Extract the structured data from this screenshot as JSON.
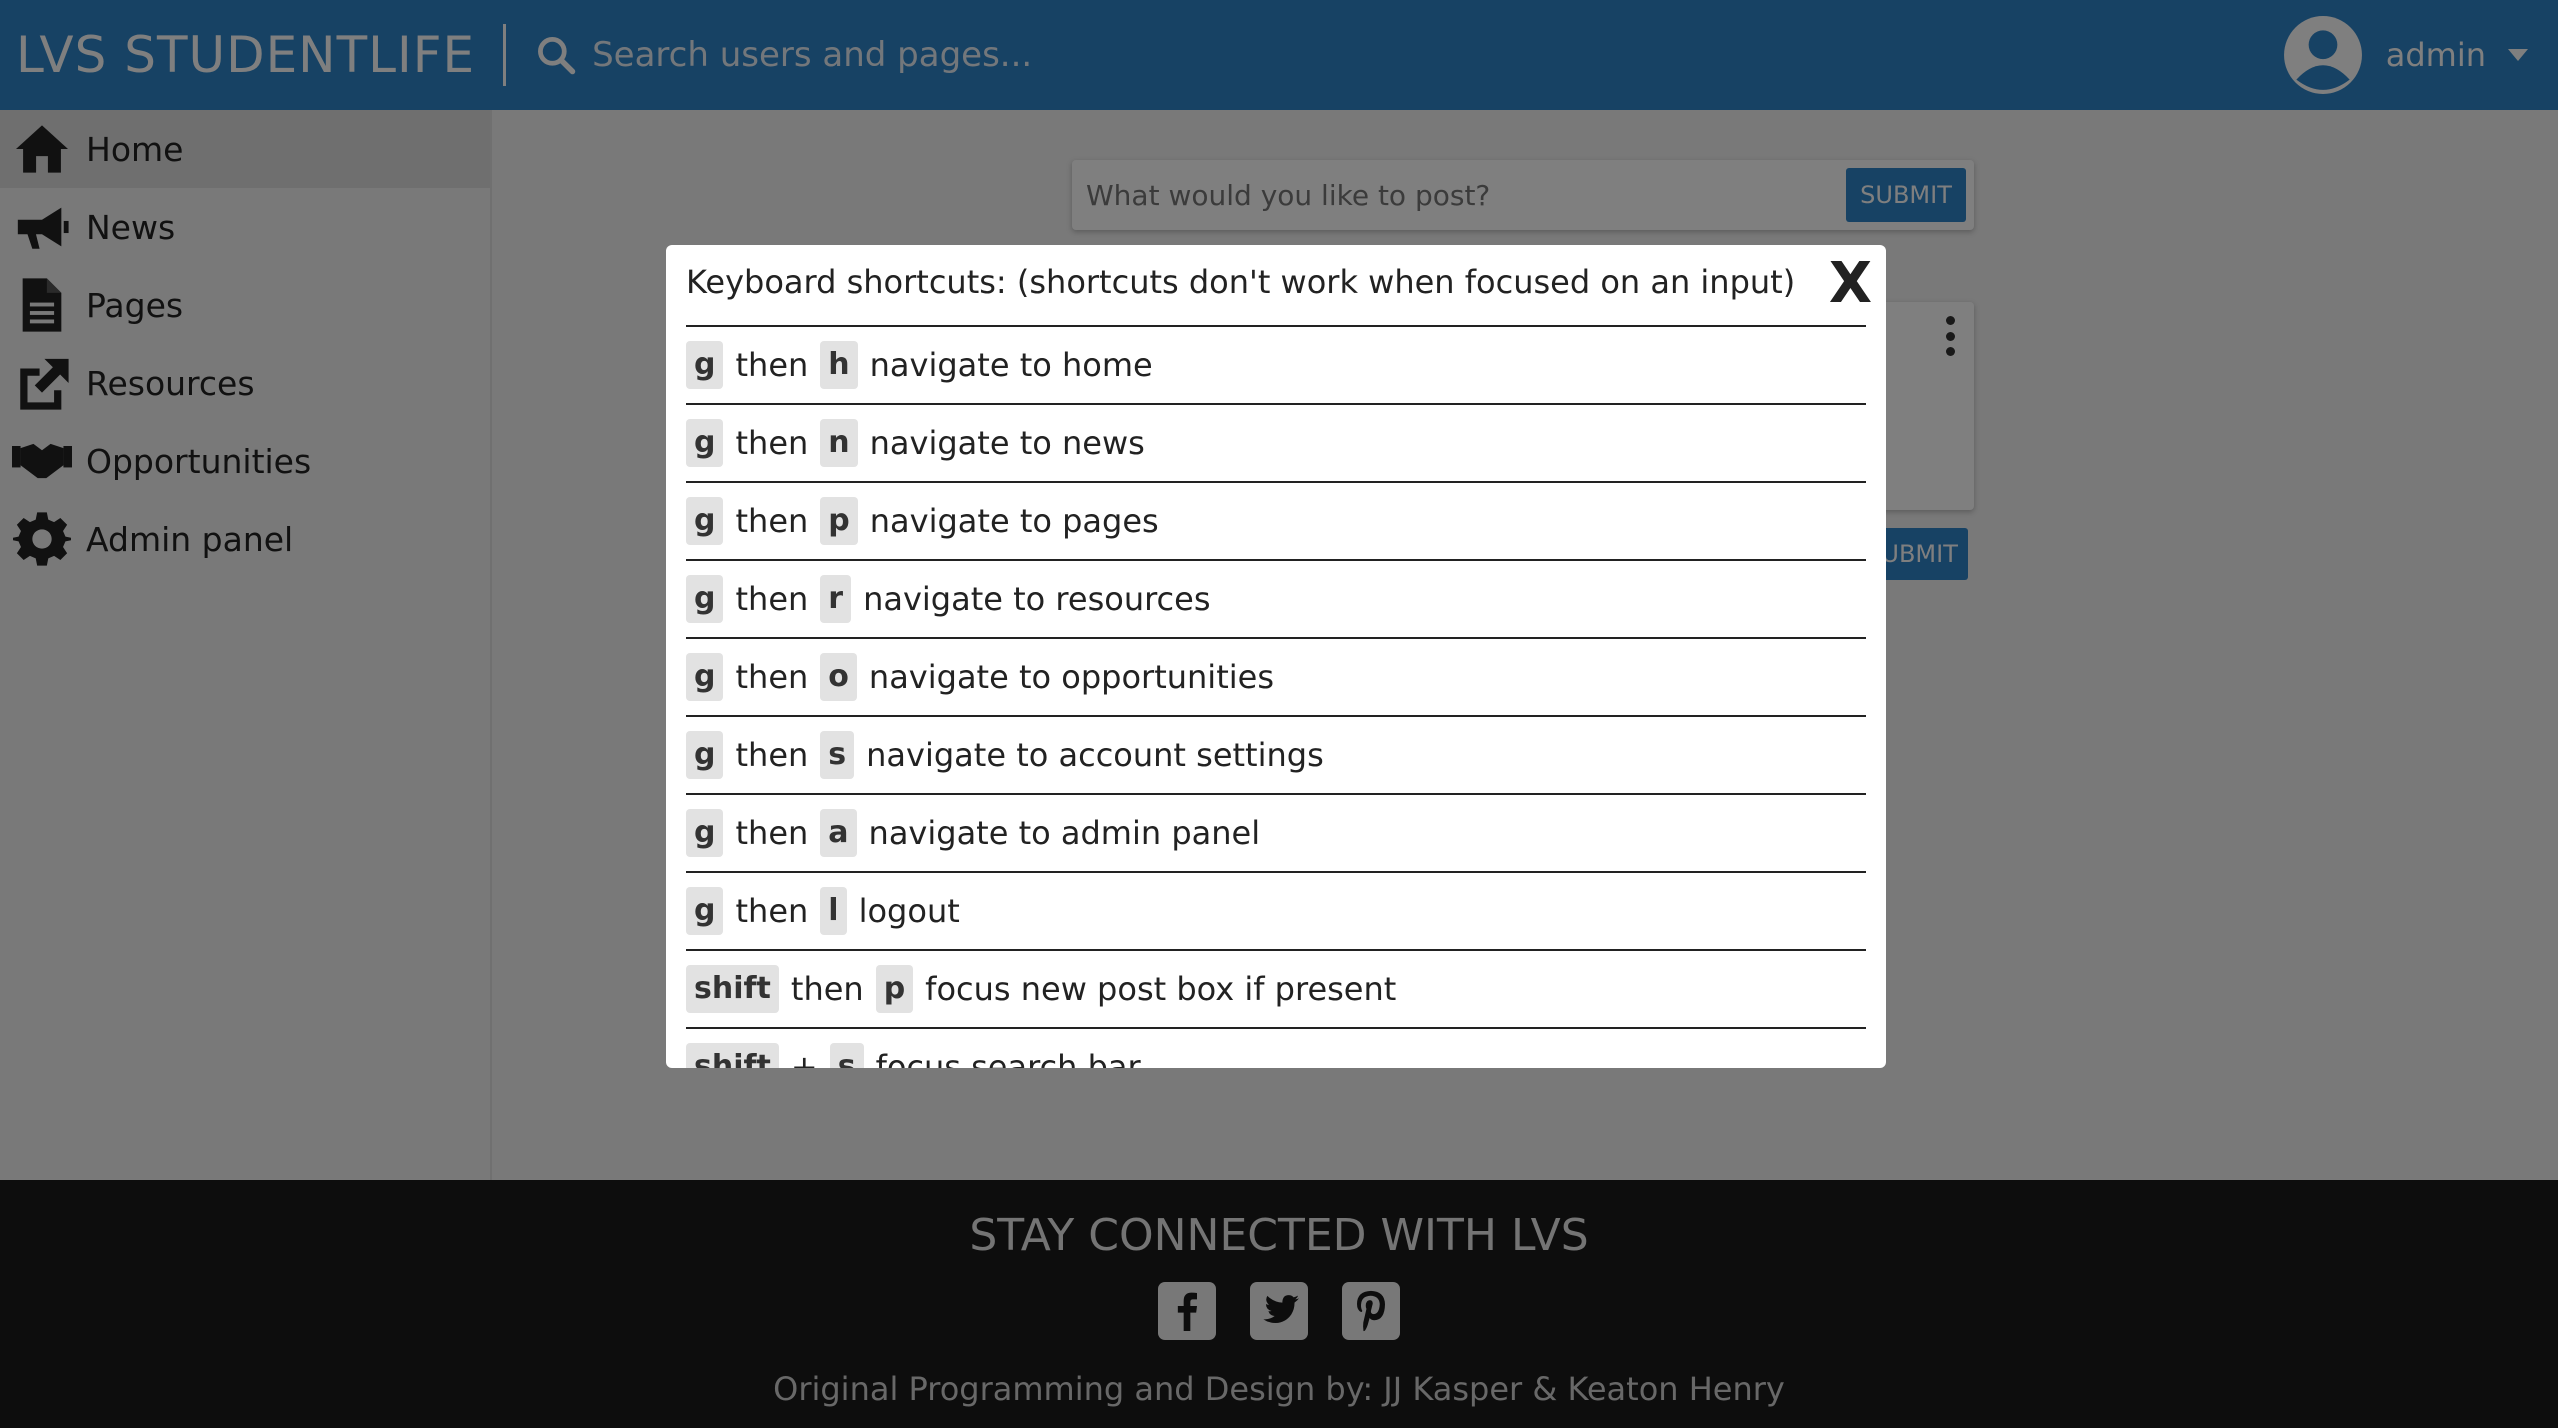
{
  "header": {
    "brand": "LVS STUDENTLIFE",
    "search_placeholder": "Search users and pages...",
    "username": "admin"
  },
  "sidebar": {
    "items": [
      {
        "label": "Home",
        "icon": "home-icon",
        "active": true
      },
      {
        "label": "News",
        "icon": "megaphone-icon"
      },
      {
        "label": "Pages",
        "icon": "document-icon"
      },
      {
        "label": "Resources",
        "icon": "external-link-icon"
      },
      {
        "label": "Opportunities",
        "icon": "handshake-icon"
      },
      {
        "label": "Admin panel",
        "icon": "gear-icon"
      }
    ]
  },
  "main": {
    "post_placeholder": "What would you like to post?",
    "submit_label": "SUBMIT",
    "submit_label_2": "SUBMIT"
  },
  "modal": {
    "title": "Keyboard shortcuts: (shortcuts don't work when focused on an input)",
    "close_label": "X",
    "shortcuts": [
      {
        "key1": "g",
        "sep": "then",
        "key2": "h",
        "desc": "navigate to home"
      },
      {
        "key1": "g",
        "sep": "then",
        "key2": "n",
        "desc": "navigate to news"
      },
      {
        "key1": "g",
        "sep": "then",
        "key2": "p",
        "desc": "navigate to pages"
      },
      {
        "key1": "g",
        "sep": "then",
        "key2": "r",
        "desc": "navigate to resources"
      },
      {
        "key1": "g",
        "sep": "then",
        "key2": "o",
        "desc": "navigate to opportunities"
      },
      {
        "key1": "g",
        "sep": "then",
        "key2": "s",
        "desc": "navigate to account settings"
      },
      {
        "key1": "g",
        "sep": "then",
        "key2": "a",
        "desc": "navigate to admin panel"
      },
      {
        "key1": "g",
        "sep": "then",
        "key2": "l",
        "desc": "logout"
      },
      {
        "key1": "shift",
        "sep": "then",
        "key2": "p",
        "desc": "focus new post box if present"
      },
      {
        "key1": "shift",
        "sep": "+",
        "key2": "s",
        "desc": "focus search bar"
      }
    ]
  },
  "footer": {
    "title": "STAY CONNECTED WITH LVS",
    "social": [
      "facebook-icon",
      "twitter-icon",
      "pinterest-icon"
    ],
    "credits": "Original Programming and Design by: JJ Kasper & Keaton Henry"
  },
  "colors": {
    "brand_blue": "#2e84c9",
    "footer_bg": "#1a1a1a"
  }
}
